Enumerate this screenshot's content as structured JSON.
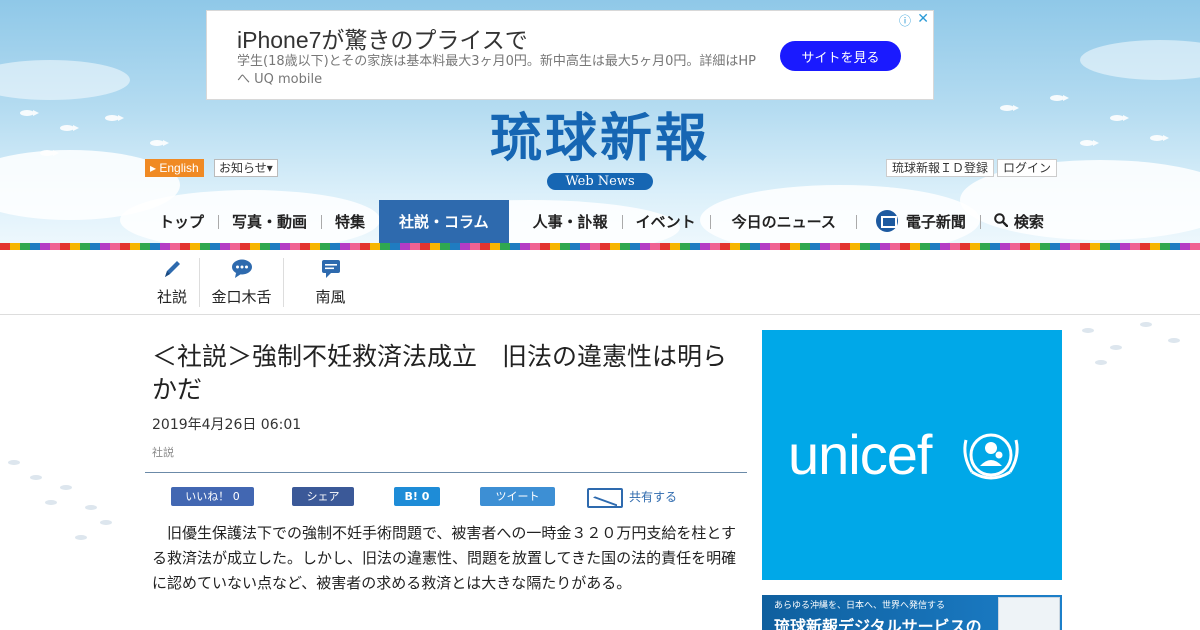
{
  "ad": {
    "title": "iPhone7が驚きのプライスで",
    "description": "学生(18歳以下)とその家族は基本料最大3ヶ月0円。新中高生は最大5ヶ月0円。詳細はHPへ UQ mobile",
    "button_label": "サイトを見る",
    "choices_glyph": "ⓘ",
    "close_glyph": "✕"
  },
  "logo": {
    "main": "琉球新報",
    "sub": "Web News"
  },
  "utility": {
    "english_label": "English",
    "notice_label": "お知らせ",
    "id_label": "琉球新報ＩＤ登録",
    "login_label": "ログイン"
  },
  "nav": {
    "items": [
      {
        "label": "トップ"
      },
      {
        "label": "写真・動画"
      },
      {
        "label": "特集"
      },
      {
        "label": "社説・コラム"
      },
      {
        "label": "人事・訃報"
      },
      {
        "label": "イベント"
      },
      {
        "label": "今日のニュース"
      },
      {
        "label": "電子新聞"
      },
      {
        "label": "検索"
      }
    ],
    "active_index": 3
  },
  "subnav": {
    "items": [
      {
        "label": "社説",
        "icon": "pen-icon"
      },
      {
        "label": "金口木舌",
        "icon": "speech-bubble-icon"
      },
      {
        "label": "南風",
        "icon": "comment-icon"
      }
    ]
  },
  "article": {
    "headline": "＜社説＞強制不妊救済法成立　旧法の違憲性は明らかだ",
    "date": "2019年4月26日 06:01",
    "category": "社説",
    "lead": "　旧優生保護法下での強制不妊手術問題で、被害者への一時金３２０万円支給を柱とする救済法が成立した。しかし、旧法の違憲性、問題を放置してきた国の法的責任を明確に認めていない点など、被害者の求める救済とは大きな隔たりがある。"
  },
  "share": {
    "like_label": "いいね！ 0",
    "facebook_label": "シェア",
    "hatena_label": "B! 0",
    "tweet_label": "ツイート",
    "mail_label": "共有する"
  },
  "sidebar": {
    "unicef_text": "unicef",
    "banner_top": "あらゆる沖縄を、日本へ、世界へ発信する",
    "banner_big": "琉球新報デジタルサービスの"
  },
  "colors": {
    "brand_blue": "#1666b3",
    "nav_active": "#2e6aae",
    "english_orange": "#f08a24",
    "ad_button": "#1a1aff",
    "unicef_blue": "#00a8e8"
  }
}
